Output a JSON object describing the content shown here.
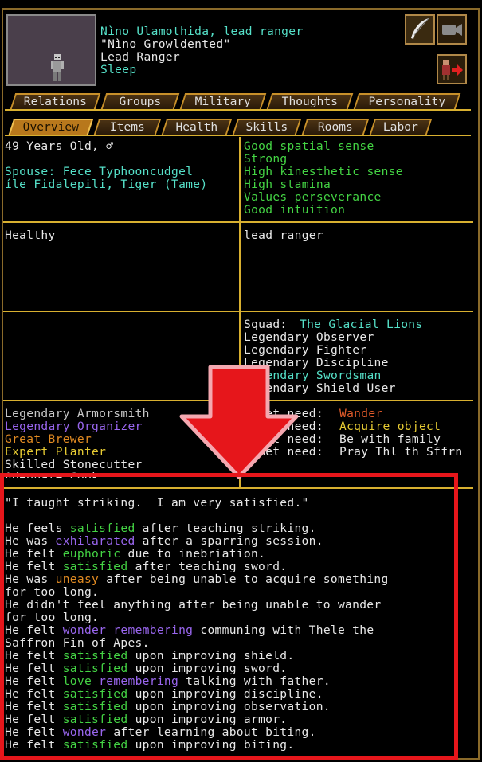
{
  "header": {
    "name": "Nìno Ulamothida, lead ranger",
    "nickname": "\"Nìno Growldented\"",
    "profession": "Lead Ranger",
    "activity": "Sleep"
  },
  "icons": {
    "portrait": "dwarf-portrait",
    "edit": "quill-icon",
    "camera": "camera-icon",
    "exit": "dwarf-exit-icon"
  },
  "tabs_top": [
    "Relations",
    "Groups",
    "Military",
    "Thoughts",
    "Personality"
  ],
  "tabs_bottom": [
    "Overview",
    "Items",
    "Health",
    "Skills",
    "Rooms",
    "Labor"
  ],
  "active_tab": "Overview",
  "overview": {
    "age": "49 Years Old, ♂",
    "spouse_line1": "Spouse: Fece Typhooncudgel",
    "spouse_line2": "íle Fidalepili, Tiger (Tame)",
    "attributes": [
      "Good spatial sense",
      "Strong",
      "High kinesthetic sense",
      "High stamina",
      "Values perseverance",
      "Good intuition"
    ],
    "health": "Healthy",
    "position": "lead ranger",
    "squad_label": "Squad:",
    "squad_name": "The Glacial Lions",
    "skills_right": [
      "Legendary Observer",
      "Legendary Fighter",
      "Legendary Discipline",
      "Legendary Swordsman",
      "Legendary Shield User"
    ],
    "skills_left": [
      "Legendary Armorsmith",
      "Legendary Organizer",
      "Great Brewer",
      "Expert Planter",
      "Skilled Stonecutter",
      "Adequate Cook"
    ],
    "needs": [
      {
        "label": "Unmet need:",
        "value": "Wander"
      },
      {
        "label": "Unmet need:",
        "value": "Acquire object"
      },
      {
        "label": "Unmet need:",
        "value": "Be with family"
      },
      {
        "label": "Unmet need:",
        "value": "Pray Thl th Sffrn"
      }
    ]
  },
  "thoughts": {
    "quote": "\"I taught striking.  I am very satisfied.\"",
    "lines": [
      [
        "He feels ",
        "satisfied",
        " after teaching striking."
      ],
      [
        "He was ",
        "exhilarated",
        " after a sparring session."
      ],
      [
        "He felt ",
        "euphoric",
        " due to inebriation."
      ],
      [
        "He felt ",
        "satisfied",
        " after teaching sword."
      ],
      [
        "He was ",
        "uneasy",
        " after being unable to acquire something"
      ],
      [
        "for too long."
      ],
      [
        "He didn't feel anything after being unable to wander"
      ],
      [
        "for too long."
      ],
      [
        "He felt ",
        "wonder remembering",
        " communing with Thele the"
      ],
      [
        "Saffron Fin of Apes."
      ],
      [
        "He felt ",
        "satisfied",
        " upon improving shield."
      ],
      [
        "He felt ",
        "satisfied",
        " upon improving sword."
      ],
      [
        "He felt ",
        "love remembering",
        " talking with father."
      ],
      [
        "He felt ",
        "satisfied",
        " upon improving discipline."
      ],
      [
        "He felt ",
        "satisfied",
        " upon improving observation."
      ],
      [
        "He felt ",
        "satisfied",
        " upon improving armor."
      ],
      [
        "He felt ",
        "wonder",
        " after learning about biting."
      ],
      [
        "He felt ",
        "satisfied",
        " upon improving biting."
      ]
    ]
  },
  "colors": {
    "cyan": "#55e0c8",
    "emotion_green": "#44d444",
    "emotion_purple": "#9966ee",
    "emotion_orange": "#e08a22",
    "highlight_red": "#e6161b"
  }
}
